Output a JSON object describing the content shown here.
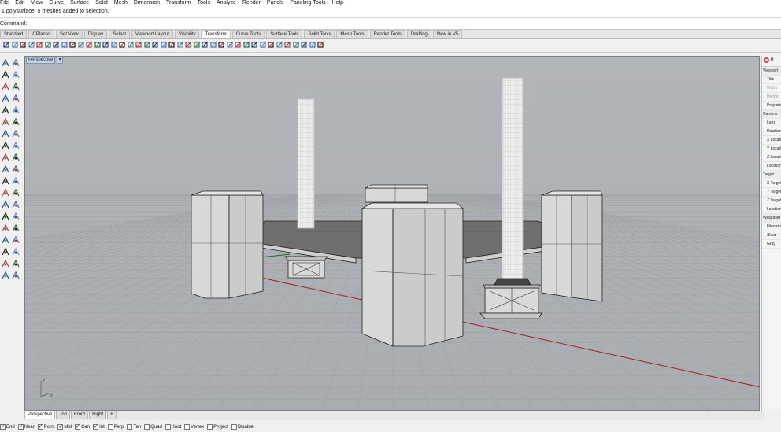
{
  "menu": [
    "File",
    "Edit",
    "View",
    "Curve",
    "Surface",
    "Solid",
    "Mesh",
    "Dimension",
    "Transform",
    "Tools",
    "Analyze",
    "Render",
    "Panels",
    "Paneling Tools",
    "Help"
  ],
  "history_line": "1 polysurface, 5 meshes added to selection.",
  "command": {
    "label": "Command:"
  },
  "toolbar_tabs": [
    {
      "label": "Standard",
      "active": false
    },
    {
      "label": "CPlanes",
      "active": false
    },
    {
      "label": "Set View",
      "active": false
    },
    {
      "label": "Display",
      "active": false
    },
    {
      "label": "Select",
      "active": false
    },
    {
      "label": "Viewport Layout",
      "active": false
    },
    {
      "label": "Visibility",
      "active": false
    },
    {
      "label": "Transform",
      "active": true
    },
    {
      "label": "Curve Tools",
      "active": false
    },
    {
      "label": "Surface Tools",
      "active": false
    },
    {
      "label": "Solid Tools",
      "active": false
    },
    {
      "label": "Mesh Tools",
      "active": false
    },
    {
      "label": "Render Tools",
      "active": false
    },
    {
      "label": "Drafting",
      "active": false
    },
    {
      "label": "New in V5",
      "active": false
    }
  ],
  "viewport": {
    "title": "Perspective",
    "menu_arrow": "▾",
    "axis_x": "x",
    "axis_y": "y",
    "bg_color": "#adb0b4",
    "grid_color": "#9ea2a7",
    "x_axis_color": "#a02020",
    "y_axis_color": "#207020"
  },
  "viewport_tabs": [
    {
      "label": "Perspective",
      "active": true
    },
    {
      "label": "Top",
      "active": false
    },
    {
      "label": "Front",
      "active": false
    },
    {
      "label": "Right",
      "active": false
    },
    {
      "label": "+",
      "active": false
    }
  ],
  "properties_panel": {
    "header": "P...",
    "rows": [
      {
        "label": "Viewport",
        "type": "sec"
      },
      {
        "label": "Title",
        "type": "row"
      },
      {
        "label": "Width",
        "type": "dim"
      },
      {
        "label": "Height",
        "type": "dim"
      },
      {
        "label": "Projection",
        "type": "row"
      },
      {
        "label": "Camera",
        "type": "sec"
      },
      {
        "label": "Lens",
        "type": "row"
      },
      {
        "label": "Rotation",
        "type": "row"
      },
      {
        "label": "X Location",
        "type": "row"
      },
      {
        "label": "Y Location",
        "type": "row"
      },
      {
        "label": "Z Location",
        "type": "row"
      },
      {
        "label": "Location",
        "type": "row"
      },
      {
        "label": "Target",
        "type": "sec"
      },
      {
        "label": "X Target",
        "type": "row"
      },
      {
        "label": "Y Target",
        "type": "row"
      },
      {
        "label": "Z Target",
        "type": "row"
      },
      {
        "label": "Location",
        "type": "row"
      },
      {
        "label": "Wallpaper",
        "type": "sec"
      },
      {
        "label": "Filename",
        "type": "row"
      },
      {
        "label": "Show",
        "type": "row"
      },
      {
        "label": "Gray",
        "type": "row"
      }
    ]
  },
  "osnaps": [
    {
      "label": "End",
      "checked": true
    },
    {
      "label": "Near",
      "checked": true
    },
    {
      "label": "Point",
      "checked": true
    },
    {
      "label": "Mid",
      "checked": true
    },
    {
      "label": "Cen",
      "checked": true
    },
    {
      "label": "Int",
      "checked": true
    },
    {
      "label": "Perp",
      "checked": false
    },
    {
      "label": "Tan",
      "checked": false
    },
    {
      "label": "Quad",
      "checked": false
    },
    {
      "label": "Knot",
      "checked": false
    },
    {
      "label": "Vertex",
      "checked": false
    },
    {
      "label": "Project",
      "checked": false
    },
    {
      "label": "Disable",
      "checked": false
    }
  ],
  "toolbar_icons": [
    "move-icon",
    "copy-icon",
    "rotate-icon",
    "rotate3d-icon",
    "scale-icon",
    "scale2d-icon",
    "scale1d-icon",
    "mirror-icon",
    "orient-icon",
    "array-icon",
    "array-polar-icon",
    "array-curve-icon",
    "align-icon",
    "twist-icon",
    "bend-icon",
    "taper-icon",
    "flow-icon",
    "splop-icon",
    "smooth-icon",
    "cage-icon",
    "stretch-icon",
    "project-icon",
    "pull-icon",
    "setpt-icon",
    "soft-move-icon",
    "shear-icon",
    "gumball-icon",
    "remap-icon",
    "cplane-icon",
    "xform-icon",
    "unroll-icon",
    "orient-crv-icon",
    "move-up-icon",
    "flip-icon",
    "offset-icon",
    "drag-icon",
    "zoom-icon",
    "repeat-icon",
    "delete-icon"
  ]
}
